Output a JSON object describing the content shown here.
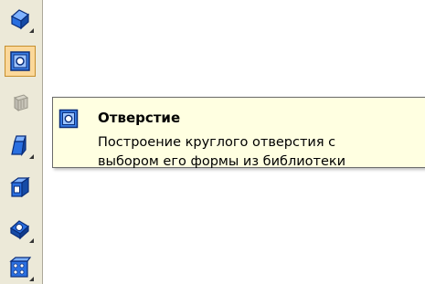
{
  "toolbar": {
    "buttons": [
      {
        "icon": "extrude-icon",
        "has_submenu": true,
        "active": false
      },
      {
        "icon": "hole-icon",
        "has_submenu": false,
        "active": true
      },
      {
        "icon": "rib-icon",
        "has_submenu": false,
        "active": false,
        "disabled": true
      },
      {
        "icon": "shell-icon",
        "has_submenu": true,
        "active": false
      },
      {
        "icon": "tapered-hole-icon",
        "has_submenu": false,
        "active": false
      },
      {
        "icon": "chamfer-icon",
        "has_submenu": true,
        "active": false
      },
      {
        "icon": "pattern-icon",
        "has_submenu": true,
        "active": false
      }
    ]
  },
  "tooltip": {
    "title": "Отверстие",
    "line1": "Построение круглого отверстия с",
    "line2": "выбором его формы из библиотеки"
  },
  "colors": {
    "toolbar_bg": "#ece9d8",
    "tooltip_bg": "#ffffe1",
    "active_button_bg": "#fbd89a",
    "icon_blue": "#1f5fbf"
  }
}
